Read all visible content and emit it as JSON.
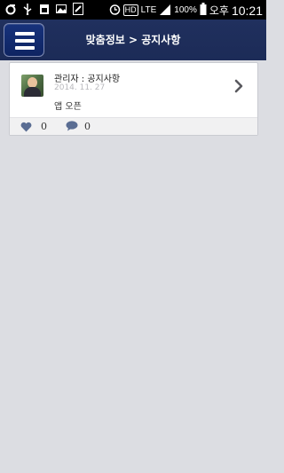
{
  "status_bar": {
    "network": "LTE",
    "hd": "HD",
    "battery": "100%",
    "ampm": "오후",
    "time": "10:21"
  },
  "header": {
    "title": "맞춤정보 > 공지사항",
    "menu_icon": "hamburger-menu-icon",
    "color": "#1f2f5e"
  },
  "posts": [
    {
      "author_label": "관리자 : 공지사항",
      "date": "2014. 11. 27",
      "title": "앱 오픈",
      "likes": "0",
      "comments": "0"
    }
  ]
}
